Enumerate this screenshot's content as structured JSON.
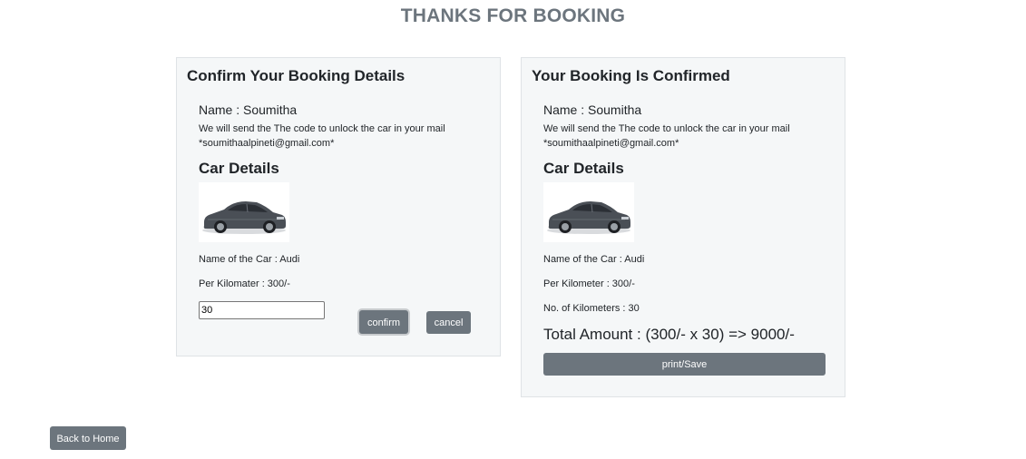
{
  "page": {
    "title": "THANKS FOR BOOKING"
  },
  "confirm_card": {
    "heading": "Confirm Your Booking Details",
    "name_line": "Name : Soumitha",
    "mail_text": "We will send the The code to unlock the car in your mail",
    "email": "*soumithaalpineti@gmail.com*",
    "car_heading": "Car Details",
    "car_name": "Name of the Car : Audi",
    "per_km": "Per Kilomater : 300/-",
    "km_input_value": "30",
    "confirm_label": "confirm",
    "cancel_label": "cancel"
  },
  "confirmed_card": {
    "heading": "Your Booking Is Confirmed",
    "name_line": "Name : Soumitha",
    "mail_text": "We will send the The code to unlock the car in your mail",
    "email": "*soumithaalpineti@gmail.com*",
    "car_heading": "Car Details",
    "car_name": "Name of the Car : Audi",
    "per_km": "Per Kilometer : 300/-",
    "num_km": "No. of Kilometers : 30",
    "total": "Total Amount : (300/- x 30) => 9000/-",
    "print_label": "print/Save"
  },
  "footer": {
    "back_label": "Back to Home"
  },
  "colors": {
    "button": "#6c757d",
    "title": "#6c757d",
    "card_bg": "#f5f7f8",
    "car_body": "#4a4f56"
  }
}
